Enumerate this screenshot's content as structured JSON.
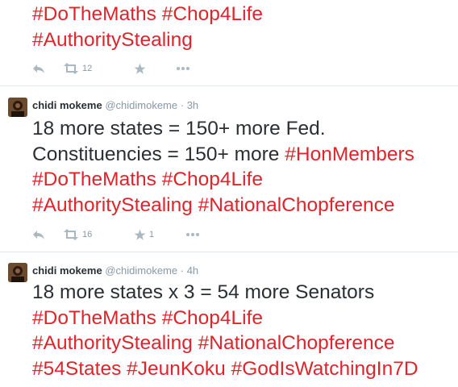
{
  "tweets": [
    {
      "lines": [
        [
          {
            "t": "#DoTheMaths",
            "tag": true
          },
          {
            "t": " ",
            "tag": false
          },
          {
            "t": "#Chop4Life",
            "tag": true
          }
        ],
        [
          {
            "t": "#AuthorityStealing",
            "tag": true
          }
        ]
      ],
      "retweets": "12",
      "favorites": ""
    },
    {
      "author_name": "chidi mokeme",
      "author_handle": "@chidimokeme",
      "sep": "·",
      "time": "3h",
      "lines": [
        [
          {
            "t": "18 more states = 150+ more Fed.",
            "tag": false
          }
        ],
        [
          {
            "t": "Constituencies = 150+ more ",
            "tag": false
          },
          {
            "t": "#HonMembers",
            "tag": true
          }
        ],
        [
          {
            "t": "#DoTheMaths",
            "tag": true
          },
          {
            "t": " ",
            "tag": false
          },
          {
            "t": "#Chop4Life",
            "tag": true
          }
        ],
        [
          {
            "t": "#AuthorityStealing",
            "tag": true
          },
          {
            "t": " ",
            "tag": false
          },
          {
            "t": "#NationalChopference",
            "tag": true
          }
        ]
      ],
      "retweets": "16",
      "favorites": "1"
    },
    {
      "author_name": "chidi mokeme",
      "author_handle": "@chidimokeme",
      "sep": "·",
      "time": "4h",
      "lines": [
        [
          {
            "t": "18 more states x 3 = 54 more Senators",
            "tag": false
          }
        ],
        [
          {
            "t": "#DoTheMaths",
            "tag": true
          },
          {
            "t": " ",
            "tag": false
          },
          {
            "t": "#Chop4Life",
            "tag": true
          }
        ],
        [
          {
            "t": "#AuthorityStealing",
            "tag": true
          },
          {
            "t": " ",
            "tag": false
          },
          {
            "t": "#NationalChopference",
            "tag": true
          }
        ],
        [
          {
            "t": "#54States",
            "tag": true
          },
          {
            "t": " ",
            "tag": false
          },
          {
            "t": "#JeunKoku",
            "tag": true
          },
          {
            "t": " ",
            "tag": false
          },
          {
            "t": "#GodIsWatchingIn7D",
            "tag": true
          }
        ]
      ]
    }
  ],
  "colors": {
    "hashtag": "#e0242b",
    "text": "#292f33",
    "meta": "#8899a6",
    "icon": "#aab8c2",
    "divider": "#e1e8ed"
  },
  "icons": {
    "reply": "reply-icon",
    "retweet": "retweet-icon",
    "favorite": "star-icon",
    "more": "more-icon"
  }
}
